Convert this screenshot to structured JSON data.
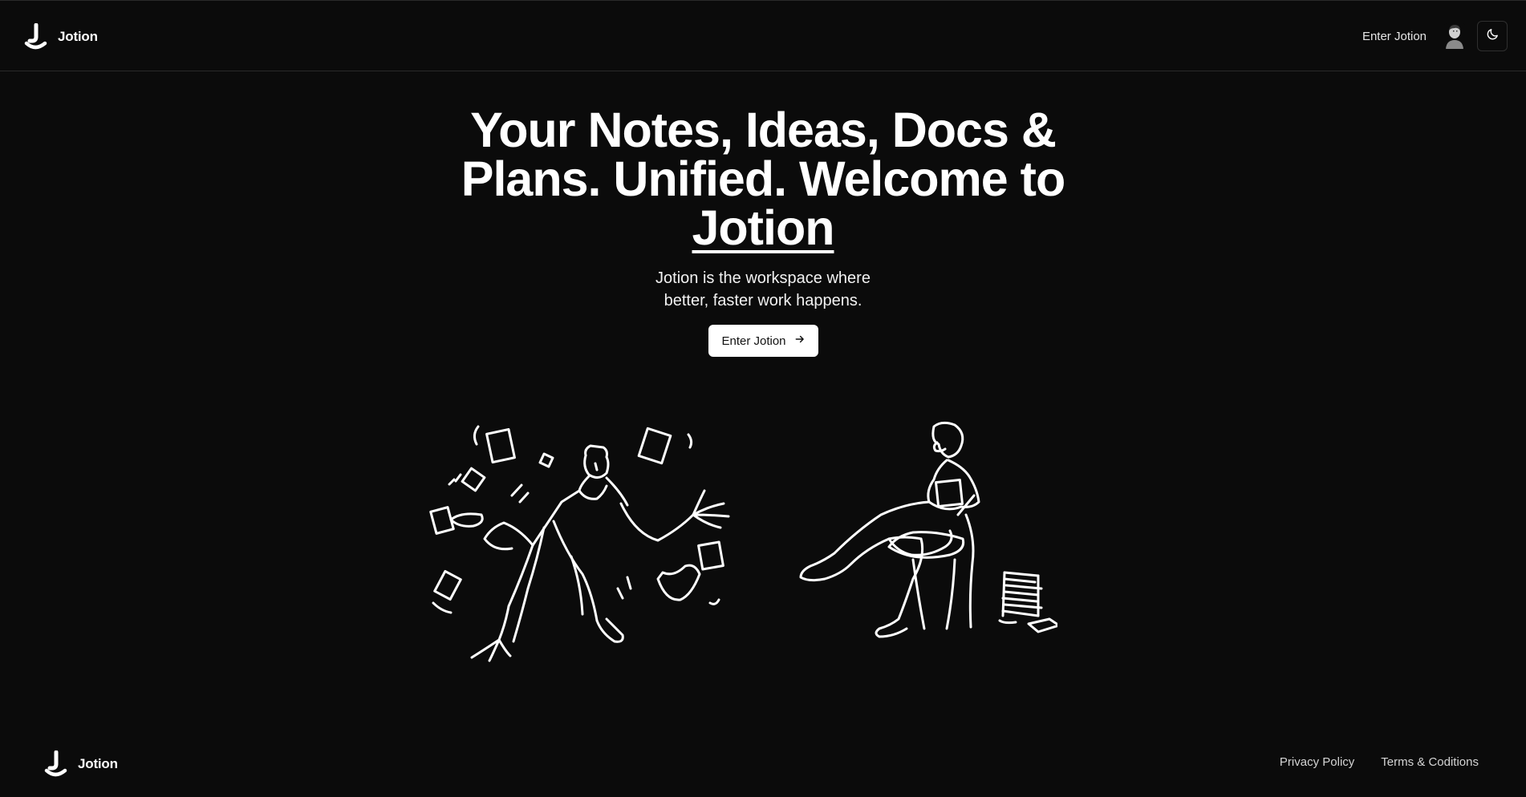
{
  "header": {
    "brand_name": "Jotion",
    "enter_link": "Enter Jotion",
    "theme_icon": "moon-icon"
  },
  "hero": {
    "title_line": "Your Notes, Ideas, Docs & Plans. Unified. Welcome to",
    "title_brand": "Jotion",
    "subtitle_line1": "Jotion is the workspace where",
    "subtitle_line2": "better, faster work happens.",
    "cta_label": "Enter Jotion",
    "cta_icon": "arrow-right-icon"
  },
  "footer": {
    "brand_name": "Jotion",
    "links": [
      "Privacy Policy",
      "Terms & Coditions"
    ]
  },
  "colors": {
    "background": "#0b0b0b",
    "text": "#ffffff",
    "button_bg": "#ffffff",
    "button_text": "#111111",
    "border": "#2a2a2a"
  }
}
